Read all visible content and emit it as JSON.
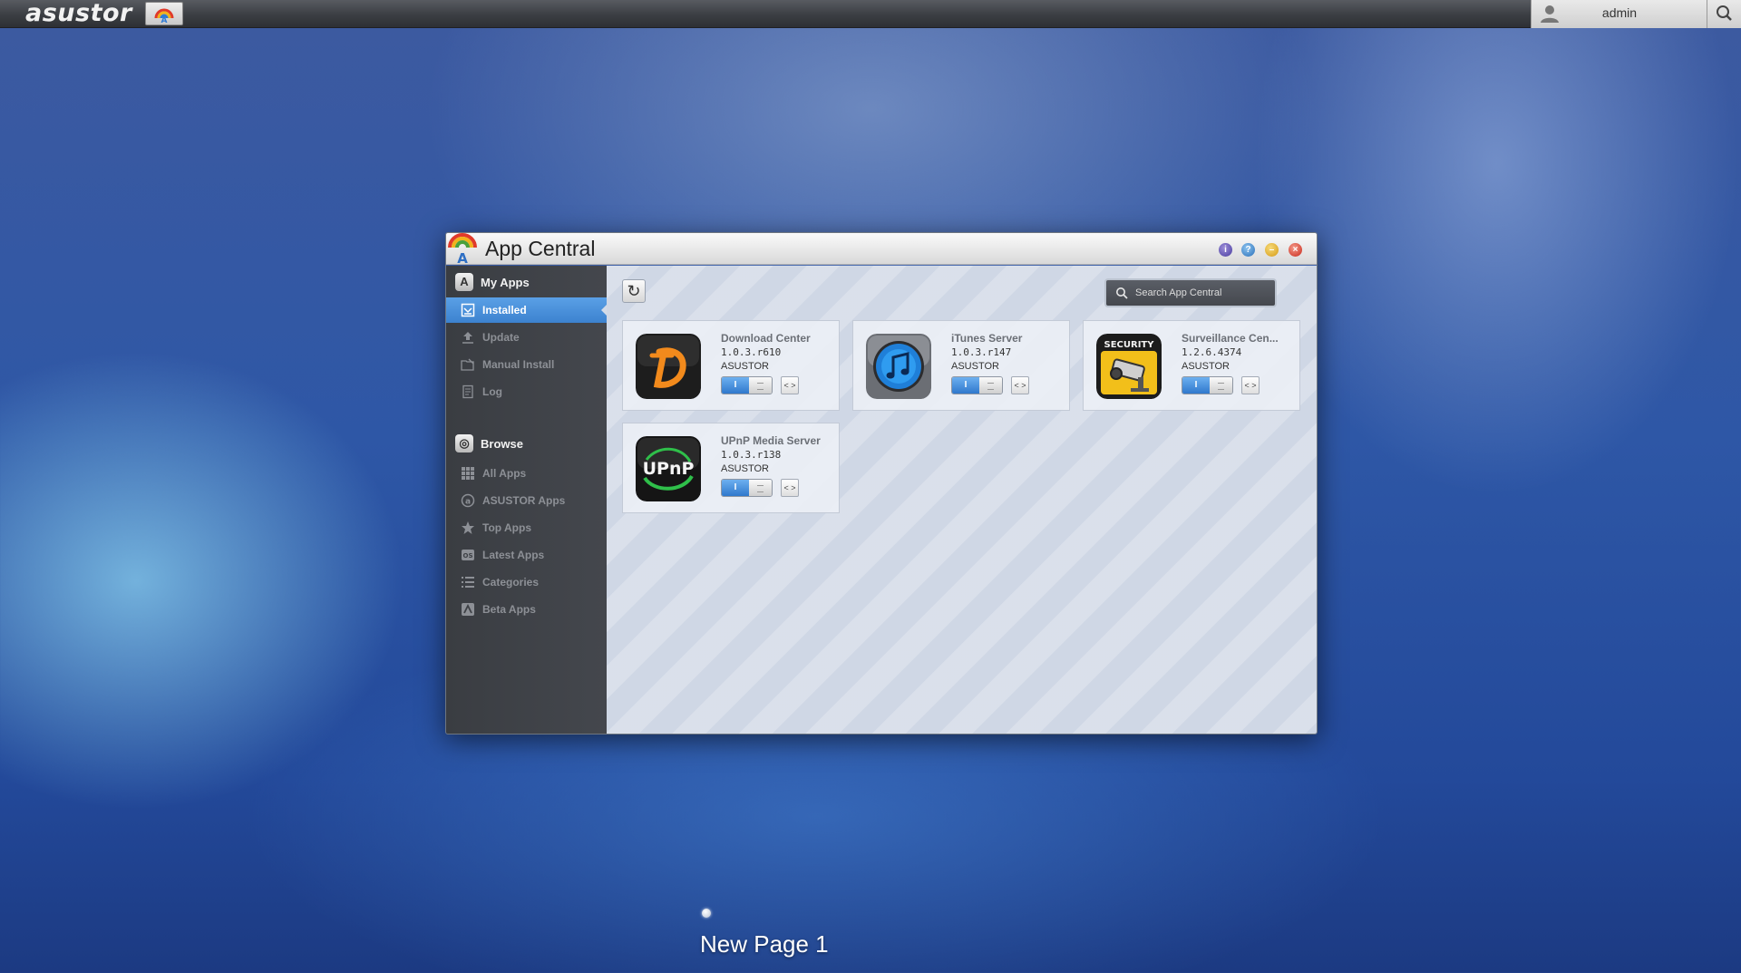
{
  "topbar": {
    "brand": "asustor",
    "user": "admin"
  },
  "window": {
    "title": "App Central"
  },
  "sidebar": {
    "sections": [
      {
        "label": "My Apps",
        "items": [
          {
            "label": "Installed",
            "icon": "installed-icon",
            "active": true
          },
          {
            "label": "Update",
            "icon": "update-icon",
            "active": false
          },
          {
            "label": "Manual Install",
            "icon": "manual-install-icon",
            "active": false
          },
          {
            "label": "Log",
            "icon": "log-icon",
            "active": false
          }
        ]
      },
      {
        "label": "Browse",
        "items": [
          {
            "label": "All Apps",
            "icon": "grid-icon",
            "active": false
          },
          {
            "label": "ASUSTOR Apps",
            "icon": "asustor-icon",
            "active": false
          },
          {
            "label": "Top Apps",
            "icon": "star-icon",
            "active": false
          },
          {
            "label": "Latest Apps",
            "icon": "new-icon",
            "active": false
          },
          {
            "label": "Categories",
            "icon": "list-icon",
            "active": false
          },
          {
            "label": "Beta Apps",
            "icon": "beta-icon",
            "active": false
          }
        ]
      }
    ]
  },
  "search": {
    "placeholder": "Search App Central"
  },
  "apps": [
    {
      "name": "Download Center",
      "version": "1.0.3.r610",
      "vendor": "ASUSTOR",
      "toggle": "I",
      "icon": "download-center-icon"
    },
    {
      "name": "iTunes Server",
      "version": "1.0.3.r147",
      "vendor": "ASUSTOR",
      "toggle": "I",
      "icon": "itunes-server-icon"
    },
    {
      "name": "Surveillance Cen...",
      "version": "1.2.6.4374",
      "vendor": "ASUSTOR",
      "toggle": "I",
      "icon": "surveillance-center-icon",
      "icon_text": "SECURITY"
    },
    {
      "name": "UPnP Media Server",
      "version": "1.0.3.r138",
      "vendor": "ASUSTOR",
      "toggle": "I",
      "icon": "upnp-media-server-icon",
      "icon_text": "UPnP"
    }
  ],
  "share_label": "< >",
  "desktop": {
    "page_label": "New Page 1"
  },
  "colors": {
    "active_item": "#3c82cf",
    "toggle_on": "#2f78cc"
  }
}
